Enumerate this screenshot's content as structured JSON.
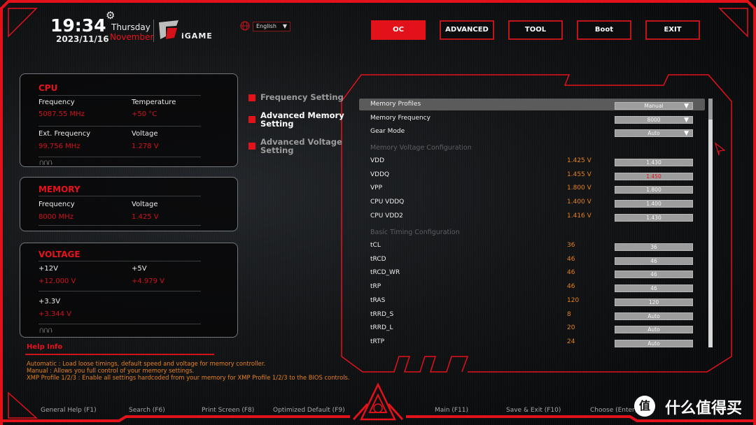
{
  "header": {
    "time": "19:34",
    "date": "2023/11/16",
    "weekday": "Thursday",
    "month": "November",
    "brand": "iGAME",
    "language": "English",
    "gear_icon": "gear-icon",
    "globe_icon": "globe-icon"
  },
  "tabs": [
    {
      "label": "OC",
      "active": true
    },
    {
      "label": "ADVANCED",
      "active": false
    },
    {
      "label": "TOOL",
      "active": false
    },
    {
      "label": "Boot",
      "active": false
    },
    {
      "label": "EXIT",
      "active": false
    }
  ],
  "cpu": {
    "title": "CPU",
    "frequency_label": "Frequency",
    "frequency": "5087.55 MHz",
    "temperature_label": "Temperature",
    "temperature": "+50 °C",
    "ext_frequency_label": "Ext. Frequency",
    "ext_frequency": "99.756 MHz",
    "voltage_label": "Voltage",
    "voltage": "1.278 V"
  },
  "memory": {
    "title": "MEMORY",
    "frequency_label": "Frequency",
    "frequency": "8000 MHz",
    "voltage_label": "Voltage",
    "voltage": "1.425 V"
  },
  "voltage": {
    "title": "VOLTAGE",
    "v12_label": "+12V",
    "v12": "+12.000 V",
    "v5_label": "+5V",
    "v5": "+4.979 V",
    "v33_label": "+3.3V",
    "v33": "+3.344 V"
  },
  "help": {
    "title": "Help Info",
    "lines": [
      "Automatic : Load loose timings, default speed and voltage for memory controller.",
      "Manual : Allows you full control of your memory settings.",
      "XMP Profile 1/2/3 : Enable all settings hardcoded from your memory for XMP Profile 1/2/3 to the BIOS controls."
    ]
  },
  "submenu": [
    {
      "label_1": "Frequency Setting",
      "label_2": "",
      "active": false
    },
    {
      "label_1": "Advanced Memory",
      "label_2": "Setting",
      "active": true
    },
    {
      "label_1": "Advanced Voltage",
      "label_2": "Setting",
      "active": false
    }
  ],
  "settings": {
    "dropdowns": [
      {
        "label": "Memory Profiles",
        "value": "Manual",
        "selected": true
      },
      {
        "label": "Memory Frequency",
        "value": "8000",
        "selected": false
      },
      {
        "label": "Gear Mode",
        "value": "Auto",
        "selected": false
      }
    ],
    "voltage_section": "Memory Voltage Configuration",
    "voltages": [
      {
        "label": "VDD",
        "current": "1.425 V",
        "value": "1.430",
        "value_color": "#f4f4f4"
      },
      {
        "label": "VDDQ",
        "current": "1.455 V",
        "value": "1.450",
        "value_color": "#e8121c"
      },
      {
        "label": "VPP",
        "current": "1.800 V",
        "value": "1.800",
        "value_color": "#f4f4f4"
      },
      {
        "label": "CPU VDDQ",
        "current": "1.400 V",
        "value": "1.400",
        "value_color": "#f4f4f4"
      },
      {
        "label": "CPU VDD2",
        "current": "1.416 V",
        "value": "1.430",
        "value_color": "#f4f4f4"
      }
    ],
    "timing_section": "Basic Timing Configuration",
    "timings": [
      {
        "label": "tCL",
        "current": "36",
        "value": "36"
      },
      {
        "label": "tRCD",
        "current": "46",
        "value": "46"
      },
      {
        "label": "tRCD_WR",
        "current": "46",
        "value": "46"
      },
      {
        "label": "tRP",
        "current": "46",
        "value": "46"
      },
      {
        "label": "tRAS",
        "current": "120",
        "value": "120"
      },
      {
        "label": "tRRD_S",
        "current": "8",
        "value": "Auto"
      },
      {
        "label": "tRRD_L",
        "current": "20",
        "value": "Auto"
      },
      {
        "label": "tRTP",
        "current": "24",
        "value": "Auto"
      }
    ]
  },
  "footer": [
    "General Help (F1)",
    "Search (F6)",
    "Print Screen (F8)",
    "Optimized Default (F9)",
    "Main (F11)",
    "Save & Exit (F10)",
    "Choose (Enter)"
  ],
  "watermark": {
    "badge": "值",
    "text": "什么值得买"
  },
  "colors": {
    "accent": "#e3121a",
    "value_orange": "#e8821c",
    "value_red": "#d0141c"
  }
}
